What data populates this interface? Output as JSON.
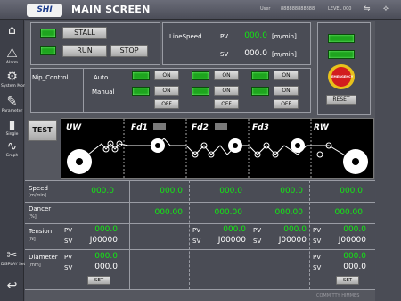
{
  "header": {
    "logo": "SHI",
    "title": "MAIN SCREEN",
    "user_label": "User",
    "user_id": "888888888888",
    "level": "LEVEL 000"
  },
  "sidebar": {
    "items": [
      {
        "label": "",
        "icon": "home-icon"
      },
      {
        "label": "Alarm",
        "icon": "alarm-icon"
      },
      {
        "label": "System Monitor",
        "icon": "system-monitor-icon"
      },
      {
        "label": "Parameter",
        "icon": "parameter-icon"
      },
      {
        "label": "Single",
        "icon": "single-icon"
      },
      {
        "label": "Graph",
        "icon": "graph-icon"
      },
      {
        "label": "DISPLAY Setting",
        "icon": "display-setting-icon"
      },
      {
        "label": "",
        "icon": "back-icon"
      }
    ]
  },
  "control": {
    "stall": "STALL",
    "run": "RUN",
    "stop": "STOP"
  },
  "line_speed": {
    "label": "LineSpeed",
    "pv_label": "PV",
    "pv": "000.0",
    "sv_label": "SV",
    "sv": "000.0",
    "unit": "[m/min]"
  },
  "emergency": {
    "text": "EMERGENCY STOP",
    "reset": "RESET"
  },
  "nip": {
    "label": "Nip_Control",
    "auto": "Auto",
    "manual": "Manual",
    "on": "ON",
    "off": "OFF"
  },
  "test": "TEST",
  "sections": [
    "UW",
    "Fd1",
    "Fd2",
    "Fd3",
    "RW"
  ],
  "rows": {
    "speed": {
      "label": "Speed",
      "unit": "[m/min]",
      "values": [
        "000.0",
        "000.0",
        "000.0",
        "000.0",
        "000.0"
      ]
    },
    "dancer": {
      "label": "Dancer",
      "unit": "[%]",
      "values": [
        "000.00",
        "000.00",
        "000.00",
        "000.00"
      ]
    },
    "tension": {
      "label": "Tension",
      "unit": "[N]",
      "pv_label": "PV",
      "sv_label": "SV",
      "pv": [
        "000.0",
        "000.0",
        "000.0",
        "000.0"
      ],
      "sv": [
        "J00000",
        "J00000",
        "J00000",
        "J00000"
      ]
    },
    "diameter": {
      "label": "Diameter",
      "unit": "[mm]",
      "pv_label": "PV",
      "sv_label": "SV",
      "pv": [
        "000.0",
        "000.0"
      ],
      "sv": [
        "000.0",
        "000.0"
      ],
      "set": "SET"
    }
  },
  "watermark": "COMMITTY HIMMES"
}
